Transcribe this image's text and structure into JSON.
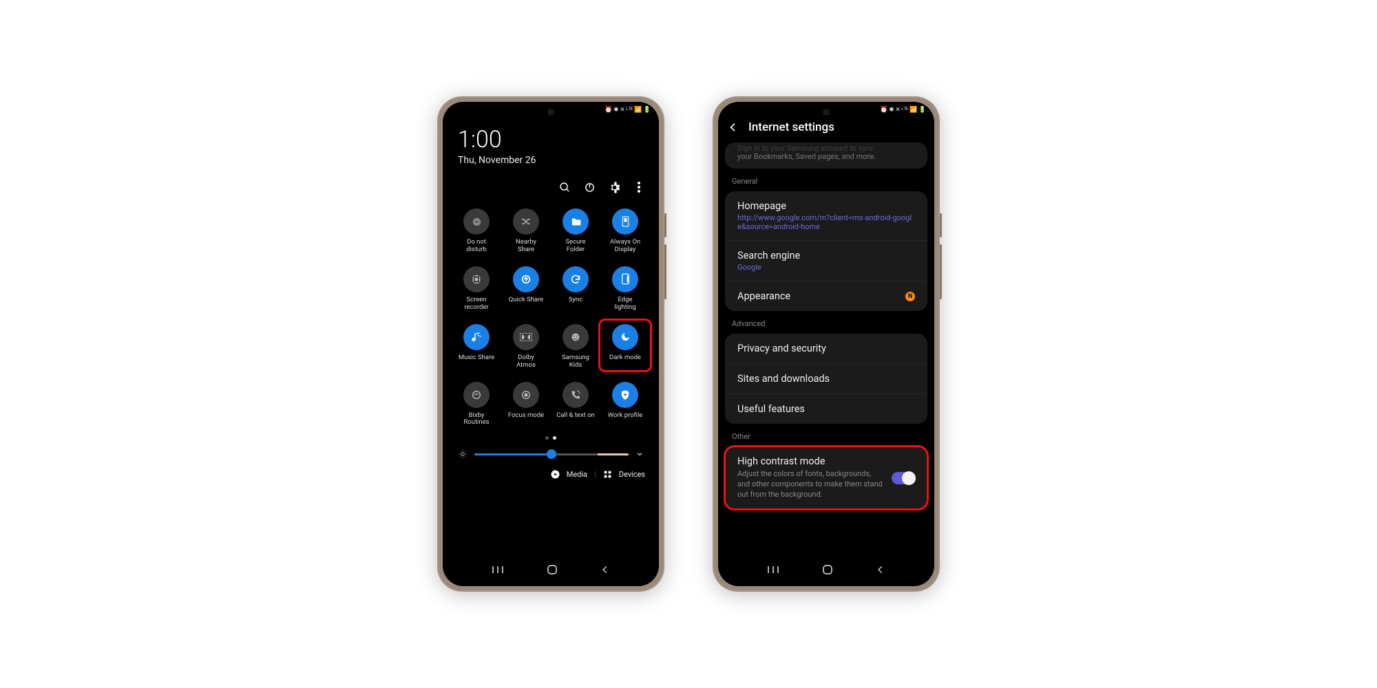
{
  "left": {
    "statusbar": "⏰ ✱ ✕ ᴸᵀᴱ 📶 🔋",
    "time": "1:00",
    "date": "Thu, November 26",
    "actions": [
      "search",
      "power",
      "settings",
      "more"
    ],
    "tiles": [
      {
        "label": "Do not\ndisturb",
        "on": false,
        "icon": "minus"
      },
      {
        "label": "Nearby\nShare",
        "on": false,
        "icon": "shuffle"
      },
      {
        "label": "Secure\nFolder",
        "on": true,
        "icon": "folder"
      },
      {
        "label": "Always On\nDisplay",
        "on": true,
        "icon": "aod"
      },
      {
        "label": "Screen\nrecorder",
        "on": false,
        "icon": "rec"
      },
      {
        "label": "Quick Share",
        "on": true,
        "icon": "qshare"
      },
      {
        "label": "Sync",
        "on": true,
        "icon": "sync"
      },
      {
        "label": "Edge\nlighting",
        "on": true,
        "icon": "edge"
      },
      {
        "label": "Music Share",
        "on": true,
        "icon": "music"
      },
      {
        "label": "Dolby\nAtmos",
        "on": false,
        "icon": "dolby"
      },
      {
        "label": "Samsung\nKids",
        "on": false,
        "icon": "kids"
      },
      {
        "label": "Dark mode",
        "on": true,
        "icon": "moon",
        "highlight": true
      },
      {
        "label": "Bixby\nRoutines",
        "on": false,
        "icon": "bixby"
      },
      {
        "label": "Focus mode",
        "on": false,
        "icon": "focus"
      },
      {
        "label": "Call & text on",
        "on": false,
        "icon": "callsync"
      },
      {
        "label": "Work profile",
        "on": true,
        "icon": "work"
      }
    ],
    "brightness": 50,
    "media": "Media",
    "devices": "Devices"
  },
  "right": {
    "statusbar": "⏰ ✱ ✕ ᴸᵀᴱ 📶 🔋",
    "title": "Internet settings",
    "sync_hint_line1": "Sign in to your Samsung account to sync",
    "sync_hint_line2": "your Bookmarks, Saved pages, and more.",
    "sections": {
      "general": "General",
      "advanced": "Advanced",
      "other": "Other"
    },
    "homepage_title": "Homepage",
    "homepage_url": "http://www.google.com/m?client=ms-android-google&source=android-home",
    "search_title": "Search engine",
    "search_value": "Google",
    "appearance": "Appearance",
    "appearance_badge": "N",
    "adv": {
      "privacy": "Privacy and security",
      "sites": "Sites and downloads",
      "useful": "Useful features"
    },
    "hc_title": "High contrast mode",
    "hc_desc": "Adjust the colors of fonts, backgrounds, and other components to make them stand out from the background.",
    "hc_on": true
  }
}
